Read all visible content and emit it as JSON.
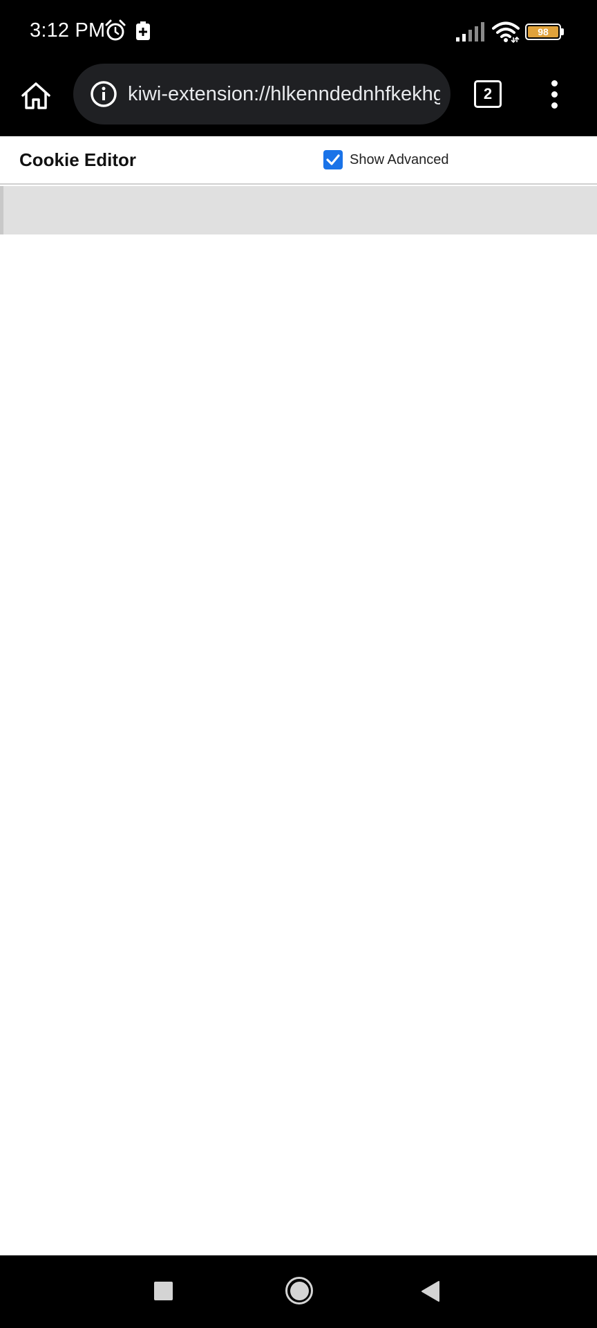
{
  "status_bar": {
    "time": "3:12 PM",
    "battery_level": "98",
    "icons": [
      "alarm-icon",
      "battery-saver-icon",
      "signal-icon",
      "wifi-icon",
      "battery-icon"
    ]
  },
  "browser": {
    "url": "kiwi-extension://hlkenndednhfkekhgcdicdfddnkalmdm",
    "tab_count": "2",
    "icons": [
      "home-icon",
      "info-icon",
      "more-vert-icon"
    ]
  },
  "extension": {
    "title": "Cookie Editor",
    "show_advanced_label": "Show Advanced",
    "show_advanced_checked": true,
    "accent_color": "#1a73e8"
  },
  "nav_bar": {
    "icons": [
      "recents-icon",
      "home-nav-icon",
      "back-icon"
    ]
  }
}
